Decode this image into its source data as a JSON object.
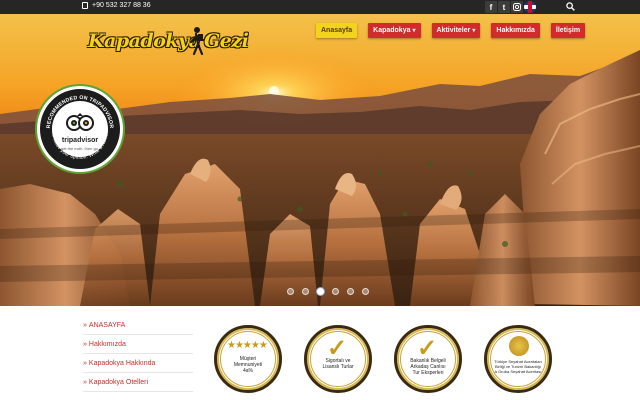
{
  "topbar": {
    "phone": "+90 532 327 88 36",
    "social": [
      "f",
      "t",
      "instagram-icon",
      "uk-flag",
      "tr-flag"
    ]
  },
  "logo": {
    "text_left": "Kapadokya",
    "text_right": "Gezi"
  },
  "nav": {
    "items": [
      {
        "label": "Anasayfa",
        "active": true,
        "dropdown": false
      },
      {
        "label": "Kapadokya",
        "active": false,
        "dropdown": true
      },
      {
        "label": "Aktiviteler",
        "active": false,
        "dropdown": true
      },
      {
        "label": "Hakkımızda",
        "active": false,
        "dropdown": false
      },
      {
        "label": "İletişim",
        "active": false,
        "dropdown": false
      }
    ]
  },
  "badge_tripadvisor": {
    "top_text": "RECOMMENDED ON TRIPADVISOR",
    "brand": "tripadvisor",
    "tagline": "get the truth. then go.",
    "bottom_text": "We value your opinion. Write a Review"
  },
  "slider": {
    "count": 6,
    "active": 2
  },
  "sidebar": {
    "items": [
      {
        "label": "ANASAYFA"
      },
      {
        "label": "Hakkımızda"
      },
      {
        "label": "Kapadokya Hakkında"
      },
      {
        "label": "Kapadokya Otelleri"
      }
    ]
  },
  "badges": [
    {
      "line1": "Müşteri",
      "line2": "Memnuniyeti",
      "line3": "4a%"
    },
    {
      "line1": "Sigortalı ve",
      "line2": "Lisanslı Turlar",
      "line3": ""
    },
    {
      "line1": "Bakanlık Belgeli",
      "line2": "Arkadaş Canlısı",
      "line3": "Tur Eksperleri"
    },
    {
      "line1": "Türkiye Seyahat Acentaları",
      "line2": "Birliği ve Turizm Bakanlığı",
      "line3": "A Gruba Seyahat Acentası"
    }
  ],
  "colors": {
    "accent_red": "#d12b2b",
    "accent_yellow": "#f2d51a",
    "topbar": "#262626"
  }
}
